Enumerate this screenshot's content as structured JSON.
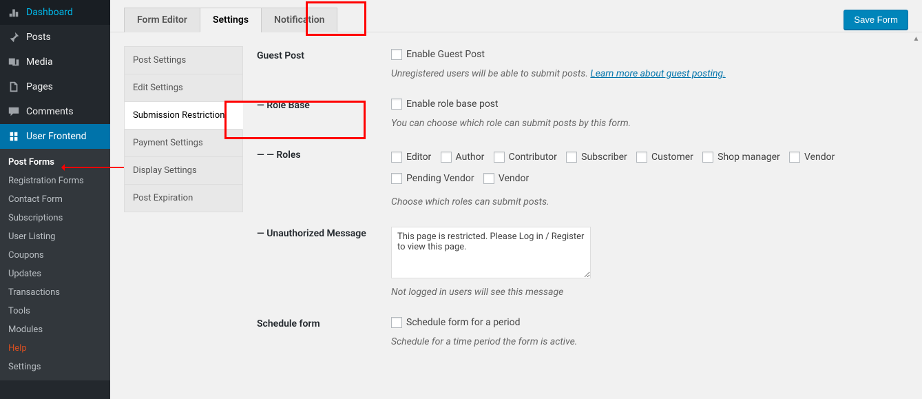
{
  "admin_menu": {
    "items": [
      {
        "label": "Dashboard",
        "icon": "dashboard"
      },
      {
        "label": "Posts",
        "icon": "pin"
      },
      {
        "label": "Media",
        "icon": "media"
      },
      {
        "label": "Pages",
        "icon": "pages"
      },
      {
        "label": "Comments",
        "icon": "comment"
      },
      {
        "label": "User Frontend",
        "icon": "uf"
      }
    ],
    "submenu": [
      {
        "label": "Post Forms"
      },
      {
        "label": "Registration Forms"
      },
      {
        "label": "Contact Form"
      },
      {
        "label": "Subscriptions"
      },
      {
        "label": "User Listing"
      },
      {
        "label": "Coupons"
      },
      {
        "label": "Updates"
      },
      {
        "label": "Transactions"
      },
      {
        "label": "Tools"
      },
      {
        "label": "Modules"
      },
      {
        "label": "Help"
      },
      {
        "label": "Settings"
      }
    ]
  },
  "top_tabs": {
    "items": [
      {
        "label": "Form Editor"
      },
      {
        "label": "Settings"
      },
      {
        "label": "Notification"
      }
    ],
    "save_button": "Save Form"
  },
  "settings_sidebar": {
    "items": [
      {
        "label": "Post Settings"
      },
      {
        "label": "Edit Settings"
      },
      {
        "label": "Submission Restriction"
      },
      {
        "label": "Payment Settings"
      },
      {
        "label": "Display Settings"
      },
      {
        "label": "Post Expiration"
      }
    ]
  },
  "fields": {
    "guest_post": {
      "label": "Guest Post",
      "checkbox_label": "Enable Guest Post",
      "hint_prefix": "Unregistered users will be able to submit posts. ",
      "hint_link": "Learn more about guest posting."
    },
    "role_base": {
      "label": "— Role Base",
      "checkbox_label": "Enable role base post",
      "hint": "You can choose which role can submit posts by this form."
    },
    "roles": {
      "label": "— — Roles",
      "options": [
        "Editor",
        "Author",
        "Contributor",
        "Subscriber",
        "Customer",
        "Shop manager",
        "Vendor",
        "Pending Vendor",
        "Vendor"
      ],
      "hint": "Choose which roles can submit posts."
    },
    "unauth": {
      "label": "— Unauthorized Message",
      "value": "This page is restricted. Please Log in / Register to view this page.",
      "hint": "Not logged in users will see this message"
    },
    "schedule": {
      "label": "Schedule form",
      "checkbox_label": "Schedule form for a period",
      "hint": "Schedule for a time period the form is active."
    }
  }
}
